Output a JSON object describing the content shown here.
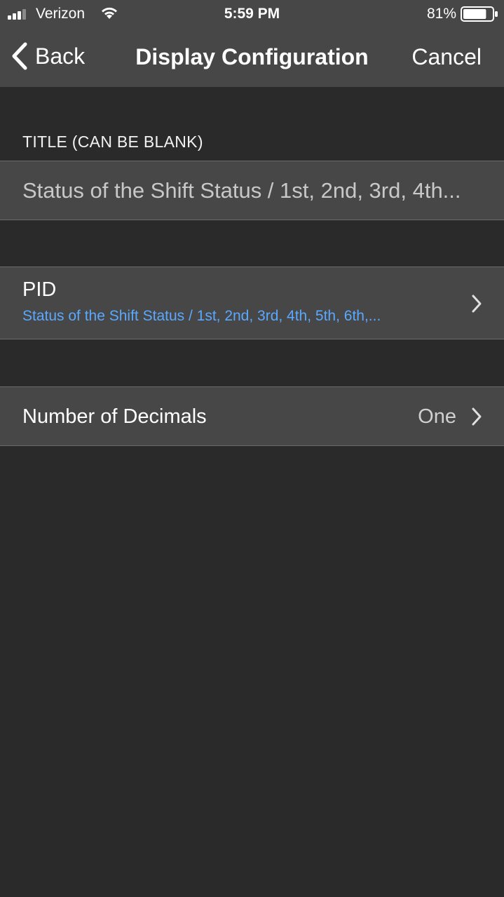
{
  "status_bar": {
    "carrier": "Verizon",
    "time": "5:59 PM",
    "battery_percent": "81%",
    "battery_level": 0.81,
    "signal_bars": 3,
    "icons": [
      "signal-icon",
      "wifi-icon",
      "battery-icon"
    ]
  },
  "nav": {
    "back_label": "Back",
    "title": "Display Configuration",
    "cancel_label": "Cancel"
  },
  "title_section": {
    "header": "TITLE (CAN BE BLANK)",
    "value": "Status of the Shift Status / 1st, 2nd, 3rd, 4th..."
  },
  "pid": {
    "label": "PID",
    "value": "Status of the Shift Status / 1st, 2nd, 3rd, 4th, 5th, 6th,..."
  },
  "decimals": {
    "label": "Number of Decimals",
    "value": "One"
  },
  "colors": {
    "background": "#2a2a2a",
    "bar": "#474747",
    "accent": "#5aa9ff"
  }
}
